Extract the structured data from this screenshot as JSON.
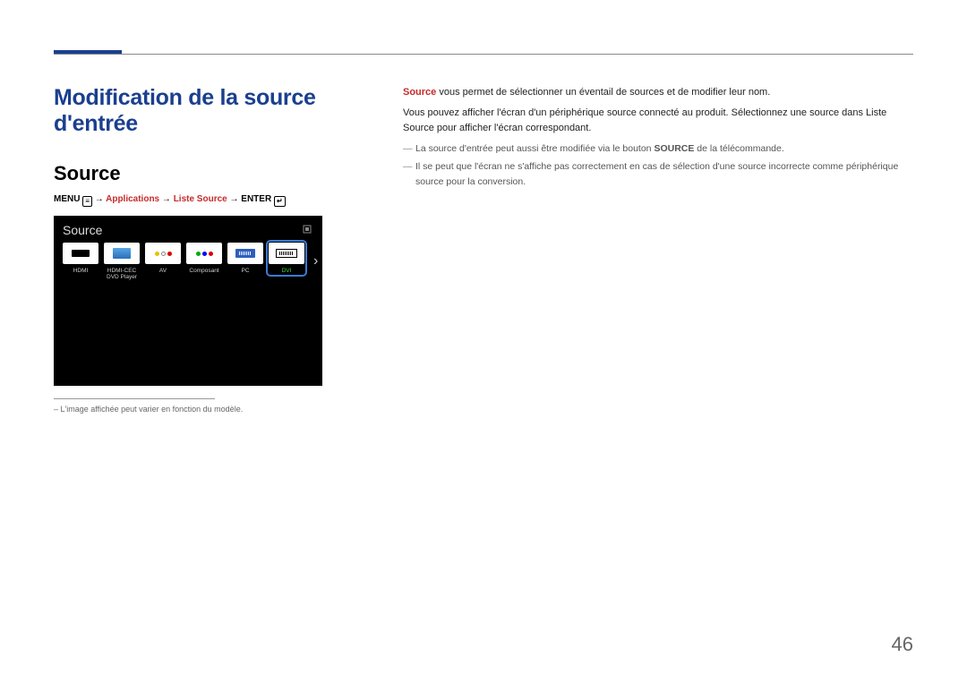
{
  "page_number": "46",
  "heading": "Modification de la source d'entrée",
  "subheading": "Source",
  "breadcrumb": {
    "menu": "MENU",
    "arrow": "→",
    "applications": "Applications",
    "liste_source": "Liste Source",
    "enter": "ENTER"
  },
  "source_panel": {
    "title": "Source",
    "tools_label": "",
    "items": [
      {
        "name": "hdmi",
        "label": "HDMI"
      },
      {
        "name": "hdmi-cec",
        "label": "HDMI-CEC\nDVD Player"
      },
      {
        "name": "av",
        "label": "AV"
      },
      {
        "name": "composant",
        "label": "Composant"
      },
      {
        "name": "pc",
        "label": "PC"
      },
      {
        "name": "dvi",
        "label": "DVI",
        "active": true
      }
    ]
  },
  "footnote": "L'image affichée peut varier en fonction du modèle.",
  "body": {
    "p1_label": "Source",
    "p1_rest": " vous permet de sélectionner un éventail de sources et de modifier leur nom.",
    "p2": "Vous pouvez afficher l'écran d'un périphérique source connecté au produit. Sélectionnez une source dans Liste Source pour afficher l'écran correspondant.",
    "li1_pre": "La source d'entrée peut aussi être modifiée via le bouton ",
    "li1_bold": "SOURCE",
    "li1_post": " de la télécommande.",
    "li2": "Il se peut que l'écran ne s'affiche pas correctement en cas de sélection d'une source incorrecte comme périphérique source pour la conversion."
  }
}
